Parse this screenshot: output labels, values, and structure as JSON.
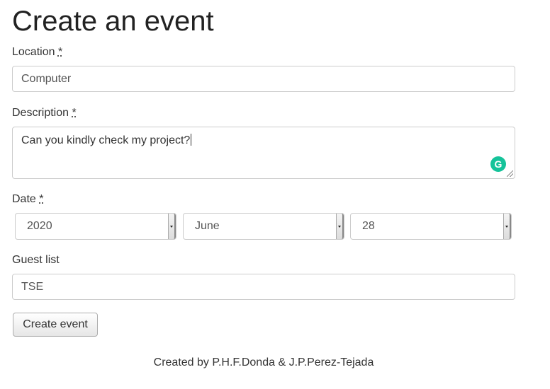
{
  "page": {
    "title": "Create an event"
  },
  "form": {
    "location": {
      "label": "Location",
      "required_mark": "*",
      "value": "Computer"
    },
    "description": {
      "label": "Description",
      "required_mark": "*",
      "value": "Can you kindly check my project?"
    },
    "date": {
      "label": "Date",
      "required_mark": "*",
      "year": "2020",
      "month": "June",
      "day": "28"
    },
    "guest_list": {
      "label": "Guest list",
      "value": "TSE"
    },
    "submit_label": "Create event"
  },
  "footer": {
    "text": "Created by P.H.F.Donda & J.P.Perez-Tejada"
  },
  "icons": {
    "grammarly": "grammarly-icon",
    "select_arrow": "chevron-down-icon"
  },
  "colors": {
    "grammarly": "#15c39a",
    "border": "#cccccc"
  }
}
